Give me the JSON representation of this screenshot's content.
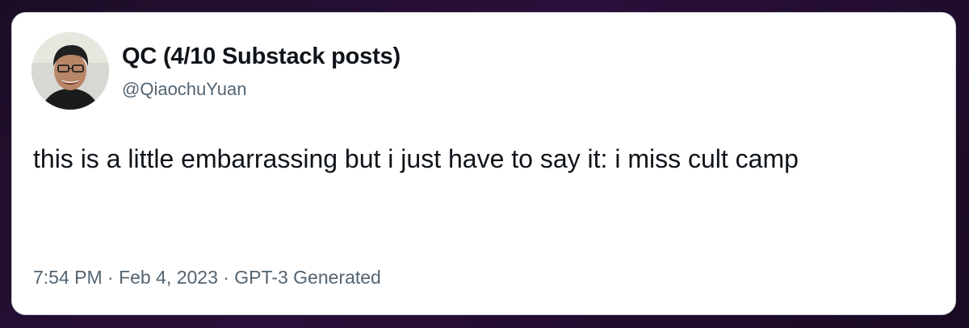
{
  "tweet": {
    "display_name": "QC (4/10 Substack posts)",
    "handle": "@QiaochuYuan",
    "text": "this is a little embarrassing but i just have to say it: i miss cult camp",
    "meta": "7:54 PM · Feb 4, 2023 · GPT-3 Generated"
  },
  "colors": {
    "background": "#230d31",
    "card": "#ffffff",
    "primary_text": "#0f1419",
    "secondary_text": "#536471"
  },
  "icons": {
    "avatar": "profile-photo"
  }
}
